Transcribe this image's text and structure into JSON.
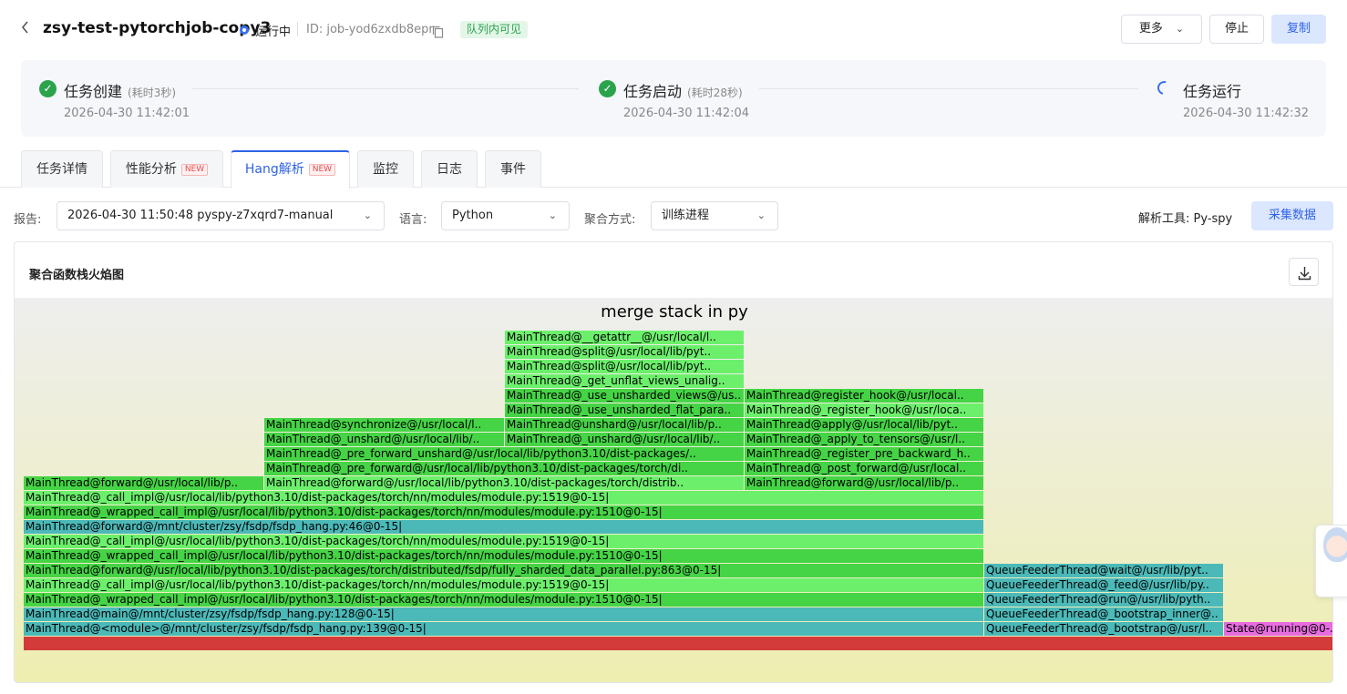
{
  "header": {
    "title": "zsy-test-pytorchjob-copy3",
    "status": "运行中",
    "job_id": "ID: job-yod6zxdb8epr",
    "visibility_badge": "队列内可见",
    "buttons": {
      "more": "更多",
      "stop": "停止",
      "copy": "复制"
    }
  },
  "progress": {
    "steps": [
      {
        "title": "任务创建",
        "duration": "(耗时3秒)",
        "time": "2026-04-30 11:42:01",
        "state": "done"
      },
      {
        "title": "任务启动",
        "duration": "(耗时28秒)",
        "time": "2026-04-30 11:42:04",
        "state": "done"
      },
      {
        "title": "任务运行",
        "duration": "",
        "time": "2026-04-30 11:42:32",
        "state": "running"
      }
    ]
  },
  "tabs": [
    {
      "label": "任务详情",
      "new": false
    },
    {
      "label": "性能分析",
      "new": true
    },
    {
      "label": "Hang解析",
      "new": true,
      "active": true
    },
    {
      "label": "监控",
      "new": false
    },
    {
      "label": "日志",
      "new": false
    },
    {
      "label": "事件",
      "new": false
    }
  ],
  "new_tag": "NEW",
  "filters": {
    "report_label": "报告:",
    "report_value": "2026-04-30 11:50:48 pyspy-z7xqrd7-manual",
    "language_label": "语言:",
    "language_value": "Python",
    "aggregate_label": "聚合方式:",
    "aggregate_value": "训练进程",
    "tool_text": "解析工具: Py-spy",
    "collect_button": "采集数据"
  },
  "panel": {
    "title": "聚合函数栈火焰图",
    "flame_title": "merge stack in py"
  },
  "flame_frames": [
    {
      "level": 0,
      "start": 0,
      "end": 1437,
      "label": "",
      "color": "#d33b3b"
    },
    {
      "level": 1,
      "start": 0,
      "end": 1053,
      "label": "MainThread@<module>@/mnt/cluster/zsy/fsdp/fsdp_hang.py:139@0-15|",
      "color": "#4bb9b8"
    },
    {
      "level": 1,
      "start": 1054,
      "end": 1316,
      "label": "QueueFeederThread@_bootstrap@/usr/l..",
      "color": "#4bb9b8"
    },
    {
      "level": 1,
      "start": 1317,
      "end": 1437,
      "label": "State@running@0-..",
      "color": "#e86ce0"
    },
    {
      "level": 2,
      "start": 0,
      "end": 1053,
      "label": "MainThread@main@/mnt/cluster/zsy/fsdp/fsdp_hang.py:128@0-15|",
      "color": "#4bb9b8"
    },
    {
      "level": 2,
      "start": 1054,
      "end": 1316,
      "label": "QueueFeederThread@_bootstrap_inner@..",
      "color": "#4bb9b8"
    },
    {
      "level": 3,
      "start": 0,
      "end": 1053,
      "label": "MainThread@_wrapped_call_impl@/usr/local/lib/python3.10/dist-packages/torch/nn/modules/module.py:1510@0-15|",
      "color": "#45d445"
    },
    {
      "level": 3,
      "start": 1054,
      "end": 1316,
      "label": "QueueFeederThread@run@/usr/lib/pyth..",
      "color": "#4bb9b8"
    },
    {
      "level": 4,
      "start": 0,
      "end": 1053,
      "label": "MainThread@_call_impl@/usr/local/lib/python3.10/dist-packages/torch/nn/modules/module.py:1519@0-15|",
      "color": "#6cf06c"
    },
    {
      "level": 4,
      "start": 1054,
      "end": 1316,
      "label": "QueueFeederThread@_feed@/usr/lib/py..",
      "color": "#4bb9b8"
    },
    {
      "level": 5,
      "start": 0,
      "end": 1053,
      "label": "MainThread@forward@/usr/local/lib/python3.10/dist-packages/torch/distributed/fsdp/fully_sharded_data_parallel.py:863@0-15|",
      "color": "#45d445"
    },
    {
      "level": 5,
      "start": 1054,
      "end": 1316,
      "label": "QueueFeederThread@wait@/usr/lib/pyt..",
      "color": "#4bb9b8"
    },
    {
      "level": 6,
      "start": 0,
      "end": 1053,
      "label": "MainThread@_wrapped_call_impl@/usr/local/lib/python3.10/dist-packages/torch/nn/modules/module.py:1510@0-15|",
      "color": "#45d445"
    },
    {
      "level": 7,
      "start": 0,
      "end": 1053,
      "label": "MainThread@_call_impl@/usr/local/lib/python3.10/dist-packages/torch/nn/modules/module.py:1519@0-15|",
      "color": "#6cf06c"
    },
    {
      "level": 8,
      "start": 0,
      "end": 1053,
      "label": "MainThread@forward@/mnt/cluster/zsy/fsdp/fsdp_hang.py:46@0-15|",
      "color": "#4bb9b8"
    },
    {
      "level": 9,
      "start": 0,
      "end": 1053,
      "label": "MainThread@_wrapped_call_impl@/usr/local/lib/python3.10/dist-packages/torch/nn/modules/module.py:1510@0-15|",
      "color": "#45d445"
    },
    {
      "level": 10,
      "start": 0,
      "end": 1053,
      "label": "MainThread@_call_impl@/usr/local/lib/python3.10/dist-packages/torch/nn/modules/module.py:1519@0-15|",
      "color": "#6cf06c"
    },
    {
      "level": 11,
      "start": 0,
      "end": 263,
      "label": "MainThread@forward@/usr/local/lib/p..",
      "color": "#45d445"
    },
    {
      "level": 11,
      "start": 264,
      "end": 790,
      "label": "MainThread@forward@/usr/local/lib/python3.10/dist-packages/torch/distrib..",
      "color": "#6cf06c"
    },
    {
      "level": 11,
      "start": 791,
      "end": 1053,
      "label": "MainThread@forward@/usr/local/lib/p..",
      "color": "#45d445"
    },
    {
      "level": 12,
      "start": 264,
      "end": 790,
      "label": "MainThread@_pre_forward@/usr/local/lib/python3.10/dist-packages/torch/di..",
      "color": "#45d445"
    },
    {
      "level": 12,
      "start": 791,
      "end": 1053,
      "label": "MainThread@_post_forward@/usr/local..",
      "color": "#45d445"
    },
    {
      "level": 13,
      "start": 264,
      "end": 790,
      "label": "MainThread@_pre_forward_unshard@/usr/local/lib/python3.10/dist-packages/..",
      "color": "#45d445"
    },
    {
      "level": 13,
      "start": 791,
      "end": 1053,
      "label": "MainThread@_register_pre_backward_h..",
      "color": "#45d445"
    },
    {
      "level": 14,
      "start": 264,
      "end": 527,
      "label": "MainThread@_unshard@/usr/local/lib/..",
      "color": "#45d445"
    },
    {
      "level": 14,
      "start": 528,
      "end": 790,
      "label": "MainThread@_unshard@/usr/local/lib/..",
      "color": "#45d445"
    },
    {
      "level": 14,
      "start": 791,
      "end": 1053,
      "label": "MainThread@_apply_to_tensors@/usr/l..",
      "color": "#45d445"
    },
    {
      "level": 15,
      "start": 264,
      "end": 527,
      "label": "MainThread@synchronize@/usr/local/l..",
      "color": "#45d445"
    },
    {
      "level": 15,
      "start": 528,
      "end": 790,
      "label": "MainThread@unshard@/usr/local/lib/p..",
      "color": "#45d445"
    },
    {
      "level": 15,
      "start": 791,
      "end": 1053,
      "label": "MainThread@apply@/usr/local/lib/pyt..",
      "color": "#45d445"
    },
    {
      "level": 16,
      "start": 528,
      "end": 790,
      "label": "MainThread@_use_unsharded_flat_para..",
      "color": "#45d445"
    },
    {
      "level": 16,
      "start": 791,
      "end": 1053,
      "label": "MainThread@_register_hook@/usr/loca..",
      "color": "#6cf06c"
    },
    {
      "level": 17,
      "start": 528,
      "end": 790,
      "label": "MainThread@_use_unsharded_views@/us..",
      "color": "#45d445"
    },
    {
      "level": 17,
      "start": 791,
      "end": 1053,
      "label": "MainThread@register_hook@/usr/local..",
      "color": "#45d445"
    },
    {
      "level": 18,
      "start": 528,
      "end": 790,
      "label": "MainThread@_get_unflat_views_unalig..",
      "color": "#6cf06c"
    },
    {
      "level": 19,
      "start": 528,
      "end": 790,
      "label": "MainThread@split@/usr/local/lib/pyt..",
      "color": "#6cf06c"
    },
    {
      "level": 20,
      "start": 528,
      "end": 790,
      "label": "MainThread@split@/usr/local/lib/pyt..",
      "color": "#6cf06c"
    },
    {
      "level": 21,
      "start": 528,
      "end": 790,
      "label": "MainThread@__getattr__@/usr/local/l..",
      "color": "#6cf06c"
    }
  ]
}
